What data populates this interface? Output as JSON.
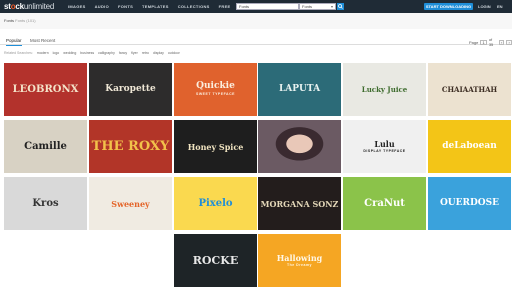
{
  "nav": {
    "logo_a": "st",
    "logo_b": "o",
    "logo_c": "ck",
    "logo_d": "unlimited",
    "links": [
      "IMAGES",
      "AUDIO",
      "FONTS",
      "TEMPLATES",
      "COLLECTIONS",
      "FREE"
    ],
    "search_value": "Fonts",
    "search_scope": "Fonts",
    "cta": "START DOWNLOADING",
    "login": "LOGIN",
    "lang": "EN"
  },
  "breadcrumb": {
    "label": "Fonts",
    "count": "Fonts (101)"
  },
  "tabs": {
    "popular": "Popular",
    "recent": "Most Recent"
  },
  "pager": {
    "label": "Page",
    "current": "1",
    "of": "of 35",
    "prev": "‹",
    "next": "›"
  },
  "related": {
    "label": "Related Searches:",
    "items": [
      "modern",
      "logo",
      "wedding",
      "business",
      "calligraphy",
      "fancy",
      "flyer",
      "retro",
      "display",
      "outdoor"
    ]
  },
  "tiles": [
    {
      "title": "LEOBRONX",
      "sub": "",
      "bg": "#b3322c",
      "fg": "#f4e3c9"
    },
    {
      "title": "Karopette",
      "sub": "",
      "bg": "#2d2c2c",
      "fg": "#efe7d6"
    },
    {
      "title": "Quickie",
      "sub": "SWEET TYPEFACE",
      "bg": "#e0622d",
      "fg": "#fbefe0"
    },
    {
      "title": "LAPUTA",
      "sub": "",
      "bg": "#2c6b78",
      "fg": "#e8f2f0"
    },
    {
      "title": "Lucky Juice",
      "sub": "",
      "bg": "#e9e9e3",
      "fg": "#3d6b2d"
    },
    {
      "title": "CHAIAATHAH",
      "sub": "",
      "bg": "#ece2d0",
      "fg": "#3b2c22"
    },
    {
      "title": "Camille",
      "sub": "",
      "bg": "#d8d2c4",
      "fg": "#222222"
    },
    {
      "title": "THE ROXY",
      "sub": "",
      "bg": "#b23528",
      "fg": "#f2c24a"
    },
    {
      "title": "Honey Spice",
      "sub": "",
      "bg": "#1e1e1e",
      "fg": "#f1e4c1"
    },
    {
      "title": "",
      "sub": "",
      "bg": "#6b5a63",
      "fg": "#ffffff"
    },
    {
      "title": "Lulu",
      "sub": "DISPLAY TYPEFACE",
      "bg": "#f0f0f0",
      "fg": "#222222"
    },
    {
      "title": "deLaboean",
      "sub": "",
      "bg": "#f3c517",
      "fg": "#ffffff"
    },
    {
      "title": "Kros",
      "sub": "",
      "bg": "#d9d9d9",
      "fg": "#333333"
    },
    {
      "title": "Sweeney",
      "sub": "",
      "bg": "#f0ebe2",
      "fg": "#e4652a"
    },
    {
      "title": "Pixelo",
      "sub": "",
      "bg": "#fad94f",
      "fg": "#1f8ed8"
    },
    {
      "title": "MORGANA SONZ",
      "sub": "",
      "bg": "#231d1c",
      "fg": "#e4d8b9"
    },
    {
      "title": "CraNut",
      "sub": "",
      "bg": "#8bc34a",
      "fg": "#ffffff"
    },
    {
      "title": "OUERDOSE",
      "sub": "",
      "bg": "#3aa2dc",
      "fg": "#ffffff"
    },
    {
      "title": "ROCKE",
      "sub": "",
      "bg": "#1e2427",
      "fg": "#e9e9e9"
    },
    {
      "title": "Hallowing",
      "sub": "The Dreamy",
      "bg": "#f5a623",
      "fg": "#fff7e6"
    }
  ]
}
